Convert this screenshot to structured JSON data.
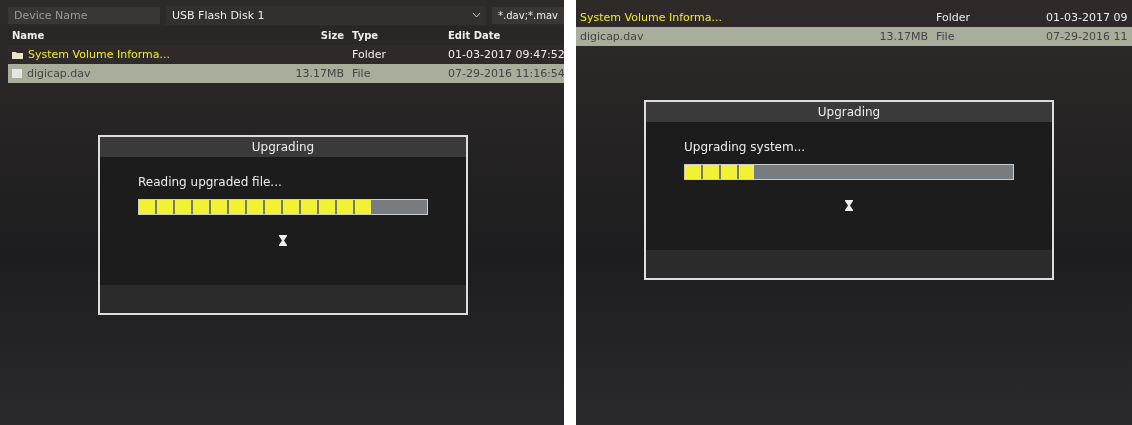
{
  "panels": [
    {
      "device": {
        "label": "Device Name",
        "value": "USB Flash Disk 1",
        "filter": "*.dav;*.mav"
      },
      "columns": [
        "Name",
        "Size",
        "Type",
        "Edit Date"
      ],
      "rows": [
        {
          "kind": "folder",
          "name": "System Volume Informa...",
          "size": "",
          "type": "Folder",
          "date": "01-03-2017 09:47:52",
          "selected": false
        },
        {
          "kind": "file",
          "name": "digicap.dav",
          "size": "13.17MB",
          "type": "File",
          "date": "07-29-2016 11:16:54",
          "selected": true
        }
      ],
      "dialog": {
        "title": "Upgrading",
        "message": "Reading upgraded file...",
        "level": 0.81
      }
    },
    {
      "rows": [
        {
          "kind": "folder",
          "name": "System Volume Informa...",
          "size": "",
          "type": "Folder",
          "date": "01-03-2017 09",
          "selected": false
        },
        {
          "kind": "file",
          "name": "digicap.dav",
          "size": "13.17MB",
          "type": "File",
          "date": "07-29-2016 11",
          "selected": true
        }
      ],
      "dialog": {
        "title": "Upgrading",
        "message": "Upgrading system...",
        "level": 0.21
      }
    }
  ]
}
